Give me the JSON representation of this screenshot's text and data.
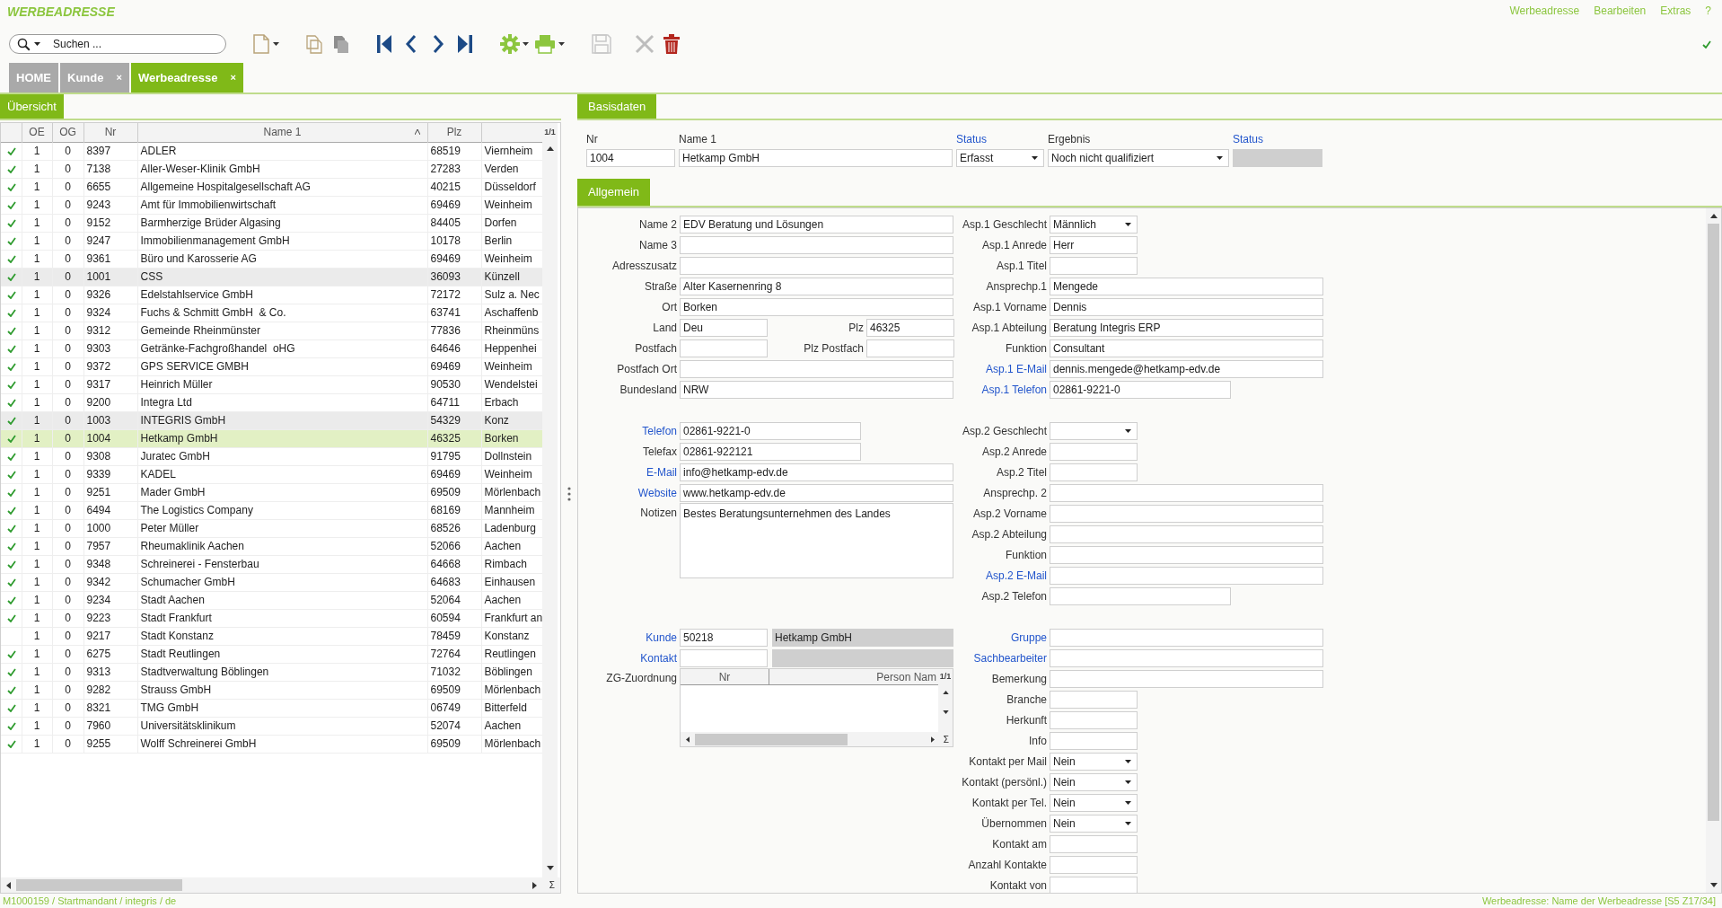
{
  "app": {
    "title": "WERBEADRESSE",
    "menu": [
      "Werbeadresse",
      "Bearbeiten",
      "Extras",
      "?"
    ]
  },
  "search": {
    "placeholder": "Suchen ..."
  },
  "tabs": [
    {
      "label": "HOME",
      "selected": false
    },
    {
      "label": "Kunde",
      "close": "×",
      "selected": false
    },
    {
      "label": "Werbeadresse",
      "close": "×",
      "selected": true
    }
  ],
  "overview": {
    "tab": "Übersicht",
    "page": "1/1",
    "sum": "Σ",
    "columns": [
      {
        "label": "OE",
        "sorted": false
      },
      {
        "label": "OG",
        "sorted": false
      },
      {
        "label": "Nr",
        "sorted": false
      },
      {
        "label": "Name 1",
        "sorted": true
      },
      {
        "label": "Plz",
        "sorted": false
      }
    ],
    "rows": [
      {
        "checked": true,
        "oe": "1",
        "og": "0",
        "nr": "8397",
        "name": "ADLER",
        "plz": "68519",
        "city": "Viernheim",
        "shaded": false,
        "selected": false
      },
      {
        "checked": true,
        "oe": "1",
        "og": "0",
        "nr": "7138",
        "name": "Aller-Weser-Klinik GmbH",
        "plz": "27283",
        "city": "Verden",
        "shaded": false,
        "selected": false
      },
      {
        "checked": true,
        "oe": "1",
        "og": "0",
        "nr": "6655",
        "name": "Allgemeine Hospitalgesellschaft AG",
        "plz": "40215",
        "city": "Düsseldorf",
        "shaded": false,
        "selected": false
      },
      {
        "checked": true,
        "oe": "1",
        "og": "0",
        "nr": "9243",
        "name": "Amt für Immobilienwirtschaft",
        "plz": "69469",
        "city": "Weinheim",
        "shaded": false,
        "selected": false
      },
      {
        "checked": true,
        "oe": "1",
        "og": "0",
        "nr": "9152",
        "name": "Barmherzige Brüder Algasing",
        "plz": "84405",
        "city": "Dorfen",
        "shaded": false,
        "selected": false
      },
      {
        "checked": true,
        "oe": "1",
        "og": "0",
        "nr": "9247",
        "name": "Immobilienmanagement GmbH",
        "plz": "10178",
        "city": "Berlin",
        "shaded": false,
        "selected": false
      },
      {
        "checked": true,
        "oe": "1",
        "og": "0",
        "nr": "9361",
        "name": "Büro und Karosserie AG",
        "plz": "69469",
        "city": "Weinheim",
        "shaded": false,
        "selected": false
      },
      {
        "checked": true,
        "oe": "1",
        "og": "0",
        "nr": "1001",
        "name": "CSS",
        "plz": "36093",
        "city": "Künzell",
        "shaded": true,
        "selected": false
      },
      {
        "checked": true,
        "oe": "1",
        "og": "0",
        "nr": "9326",
        "name": "Edelstahlservice GmbH",
        "plz": "72172",
        "city": "Sulz a. Nec",
        "shaded": false,
        "selected": false
      },
      {
        "checked": true,
        "oe": "1",
        "og": "0",
        "nr": "9324",
        "name": "Fuchs & Schmitt GmbH  & Co.",
        "plz": "63741",
        "city": "Aschaffenb",
        "shaded": false,
        "selected": false
      },
      {
        "checked": true,
        "oe": "1",
        "og": "0",
        "nr": "9312",
        "name": "Gemeinde Rheinmünster",
        "plz": "77836",
        "city": "Rheinmüns",
        "shaded": false,
        "selected": false
      },
      {
        "checked": true,
        "oe": "1",
        "og": "0",
        "nr": "9303",
        "name": "Getränke-Fachgroßhandel  oHG",
        "plz": "64646",
        "city": "Heppenhei",
        "shaded": false,
        "selected": false
      },
      {
        "checked": true,
        "oe": "1",
        "og": "0",
        "nr": "9372",
        "name": "GPS SERVICE GMBH",
        "plz": "69469",
        "city": "Weinheim",
        "shaded": false,
        "selected": false
      },
      {
        "checked": true,
        "oe": "1",
        "og": "0",
        "nr": "9317",
        "name": "Heinrich Müller",
        "plz": "90530",
        "city": "Wendelstei",
        "shaded": false,
        "selected": false
      },
      {
        "checked": true,
        "oe": "1",
        "og": "0",
        "nr": "9200",
        "name": "Integra Ltd",
        "plz": "64711",
        "city": "Erbach",
        "shaded": false,
        "selected": false
      },
      {
        "checked": true,
        "oe": "1",
        "og": "0",
        "nr": "1003",
        "name": "INTEGRIS GmbH",
        "plz": "54329",
        "city": "Konz",
        "shaded": true,
        "selected": false
      },
      {
        "checked": true,
        "oe": "1",
        "og": "0",
        "nr": "1004",
        "name": "Hetkamp GmbH",
        "plz": "46325",
        "city": "Borken",
        "shaded": false,
        "selected": true
      },
      {
        "checked": true,
        "oe": "1",
        "og": "0",
        "nr": "9308",
        "name": "Juratec GmbH",
        "plz": "91795",
        "city": "Dollnstein",
        "shaded": false,
        "selected": false
      },
      {
        "checked": true,
        "oe": "1",
        "og": "0",
        "nr": "9339",
        "name": "KADEL",
        "plz": "69469",
        "city": "Weinheim",
        "shaded": false,
        "selected": false
      },
      {
        "checked": true,
        "oe": "1",
        "og": "0",
        "nr": "9251",
        "name": "Mader GmbH",
        "plz": "69509",
        "city": "Mörlenbach",
        "shaded": false,
        "selected": false
      },
      {
        "checked": true,
        "oe": "1",
        "og": "0",
        "nr": "6494",
        "name": "The Logistics Company",
        "plz": "68169",
        "city": "Mannheim",
        "shaded": false,
        "selected": false
      },
      {
        "checked": true,
        "oe": "1",
        "og": "0",
        "nr": "1000",
        "name": "Peter Müller",
        "plz": "68526",
        "city": "Ladenburg",
        "shaded": false,
        "selected": false
      },
      {
        "checked": true,
        "oe": "1",
        "og": "0",
        "nr": "7957",
        "name": "Rheumaklinik Aachen",
        "plz": "52066",
        "city": "Aachen",
        "shaded": false,
        "selected": false
      },
      {
        "checked": true,
        "oe": "1",
        "og": "0",
        "nr": "9348",
        "name": "Schreinerei - Fensterbau",
        "plz": "64668",
        "city": "Rimbach",
        "shaded": false,
        "selected": false
      },
      {
        "checked": true,
        "oe": "1",
        "og": "0",
        "nr": "9342",
        "name": "Schumacher GmbH",
        "plz": "64683",
        "city": "Einhausen",
        "shaded": false,
        "selected": false
      },
      {
        "checked": true,
        "oe": "1",
        "og": "0",
        "nr": "9234",
        "name": "Stadt Aachen",
        "plz": "52064",
        "city": "Aachen",
        "shaded": false,
        "selected": false
      },
      {
        "checked": true,
        "oe": "1",
        "og": "0",
        "nr": "9223",
        "name": "Stadt Frankfurt",
        "plz": "60594",
        "city": "Frankfurt an",
        "shaded": false,
        "selected": false
      },
      {
        "checked": false,
        "oe": "1",
        "og": "0",
        "nr": "9217",
        "name": "Stadt Konstanz",
        "plz": "78459",
        "city": "Konstanz",
        "shaded": false,
        "selected": false
      },
      {
        "checked": true,
        "oe": "1",
        "og": "0",
        "nr": "6275",
        "name": "Stadt Reutlingen",
        "plz": "72764",
        "city": "Reutlingen",
        "shaded": false,
        "selected": false
      },
      {
        "checked": true,
        "oe": "1",
        "og": "0",
        "nr": "9313",
        "name": "Stadtverwaltung Böblingen",
        "plz": "71032",
        "city": "Böblingen",
        "shaded": false,
        "selected": false
      },
      {
        "checked": true,
        "oe": "1",
        "og": "0",
        "nr": "9282",
        "name": "Strauss GmbH",
        "plz": "69509",
        "city": "Mörlenbach",
        "shaded": false,
        "selected": false
      },
      {
        "checked": true,
        "oe": "1",
        "og": "0",
        "nr": "8321",
        "name": "TMG GmbH",
        "plz": "06749",
        "city": "Bitterfeld",
        "shaded": false,
        "selected": false
      },
      {
        "checked": true,
        "oe": "1",
        "og": "0",
        "nr": "7960",
        "name": "Universitätsklinikum",
        "plz": "52074",
        "city": "Aachen",
        "shaded": false,
        "selected": false
      },
      {
        "checked": true,
        "oe": "1",
        "og": "0",
        "nr": "9255",
        "name": "Wolff Schreinerei GmbH",
        "plz": "69509",
        "city": "Mörlenbach",
        "shaded": false,
        "selected": false
      }
    ]
  },
  "basis": {
    "tab": "Basisdaten",
    "fields": [
      {
        "label": "Nr",
        "value": "1004",
        "kind": "text",
        "link": false
      },
      {
        "label": "Name 1",
        "value": "Hetkamp GmbH",
        "kind": "text",
        "link": false
      },
      {
        "label": "Status",
        "value": "Erfasst",
        "kind": "select",
        "link": true
      },
      {
        "label": "Ergebnis",
        "value": "Noch nicht qualifiziert",
        "kind": "select",
        "link": false
      },
      {
        "label": "Status",
        "kind": "readonly",
        "link": true
      }
    ]
  },
  "general": {
    "tab": "Allgemein",
    "left": [
      [
        {
          "label": "Name 2",
          "value": "EDV Beratung und Lösungen",
          "kind": "text",
          "link": false
        },
        {
          "label": "Name 3",
          "kind": "text",
          "link": false
        },
        {
          "label": "Adresszusatz",
          "kind": "text",
          "link": false
        },
        {
          "label": "Straße",
          "value": "Alter Kasernenring 8",
          "kind": "text",
          "link": false
        },
        {
          "label": "Ort",
          "value": "Borken",
          "kind": "text",
          "link": false
        },
        {
          "label": "Land",
          "value": "Deu",
          "kind": "pair",
          "link": false,
          "label2": "Plz",
          "value2": "46325"
        },
        {
          "label": "Postfach",
          "kind": "pair",
          "link": false,
          "label2": "Plz Postfach"
        },
        {
          "label": "Postfach Ort",
          "kind": "text",
          "link": false
        },
        {
          "label": "Bundesland",
          "value": "NRW",
          "kind": "text",
          "link": false
        }
      ],
      [
        {
          "label": "Telefon",
          "value": "02861-9221-0",
          "kind": "medium",
          "link": true
        },
        {
          "label": "Telefax",
          "value": "02861-922121",
          "kind": "medium",
          "link": false
        },
        {
          "label": "E-Mail",
          "value": "info@hetkamp-edv.de",
          "kind": "text",
          "link": true
        },
        {
          "label": "Website",
          "value": "www.hetkamp-edv.de",
          "kind": "text",
          "link": true
        },
        {
          "label": "Notizen",
          "value": "Bestes Beratungsunternehmen des Landes",
          "kind": "memo",
          "link": false
        }
      ],
      [
        {
          "label": "Kunde",
          "value": "50218",
          "value2": "Hetkamp GmbH",
          "kind": "lookup",
          "link": true
        },
        {
          "label": "Kontakt",
          "kind": "lookup",
          "link": true
        },
        {
          "label": "ZG-Zuordnung",
          "kind": "grid",
          "link": false,
          "columns": [
            "Nr",
            "Person Nam"
          ],
          "page": "1/1",
          "sum": "Σ"
        }
      ]
    ],
    "right": [
      [
        {
          "label": "Asp.1 Geschlecht",
          "value": "Männlich",
          "kind": "select",
          "link": false
        },
        {
          "label": "Asp.1 Anrede",
          "value": "Herr",
          "kind": "short",
          "link": false
        },
        {
          "label": "Asp.1 Titel",
          "kind": "short",
          "link": false
        },
        {
          "label": "Ansprechp.1",
          "value": "Mengede",
          "kind": "text",
          "link": false
        },
        {
          "label": "Asp.1 Vorname",
          "value": "Dennis",
          "kind": "text",
          "link": false
        },
        {
          "label": "Asp.1 Abteilung",
          "value": "Beratung Integris ERP",
          "kind": "text",
          "link": false
        },
        {
          "label": "Funktion",
          "value": "Consultant",
          "kind": "text",
          "link": false
        },
        {
          "label": "Asp.1 E-Mail",
          "value": "dennis.mengede@hetkamp-edv.de",
          "kind": "text",
          "link": true
        },
        {
          "label": "Asp.1 Telefon",
          "value": "02861-9221-0",
          "kind": "medium",
          "link": true
        }
      ],
      [
        {
          "label": "Asp.2 Geschlecht",
          "kind": "select",
          "link": false
        },
        {
          "label": "Asp.2 Anrede",
          "kind": "short",
          "link": false
        },
        {
          "label": "Asp.2 Titel",
          "kind": "short",
          "link": false
        },
        {
          "label": "Ansprechp. 2",
          "kind": "text",
          "link": false
        },
        {
          "label": "Asp.2 Vorname",
          "kind": "text",
          "link": false
        },
        {
          "label": "Asp.2 Abteilung",
          "kind": "text",
          "link": false
        },
        {
          "label": "Funktion",
          "kind": "text",
          "link": false
        },
        {
          "label": "Asp.2 E-Mail",
          "kind": "text",
          "link": true
        },
        {
          "label": "Asp.2 Telefon",
          "kind": "medium",
          "link": false
        }
      ],
      [
        {
          "label": "Gruppe",
          "kind": "text",
          "link": true
        },
        {
          "label": "Sachbearbeiter",
          "kind": "text",
          "link": true
        },
        {
          "label": "Bemerkung",
          "kind": "text",
          "link": false
        },
        {
          "label": "Branche",
          "kind": "short",
          "link": false
        },
        {
          "label": "Herkunft",
          "kind": "short",
          "link": false
        },
        {
          "label": "Info",
          "kind": "short",
          "link": false
        },
        {
          "label": "Kontakt per Mail",
          "value": "Nein",
          "kind": "select",
          "link": false
        },
        {
          "label": "Kontakt (persönl.)",
          "value": "Nein",
          "kind": "select",
          "link": false
        },
        {
          "label": "Kontakt per Tel.",
          "value": "Nein",
          "kind": "select",
          "link": false
        },
        {
          "label": "Übernommen",
          "value": "Nein",
          "kind": "select",
          "link": false
        },
        {
          "label": "Kontakt am",
          "kind": "short",
          "link": false
        },
        {
          "label": "Anzahl Kontakte",
          "kind": "short",
          "link": false
        },
        {
          "label": "Kontakt von",
          "kind": "short",
          "link": false
        }
      ]
    ]
  },
  "status_bar": {
    "left": "M1000159 / Startmandant / integris / de",
    "right": "Werbeadresse: Name der Werbeadresse [S5 Z17/34]"
  }
}
